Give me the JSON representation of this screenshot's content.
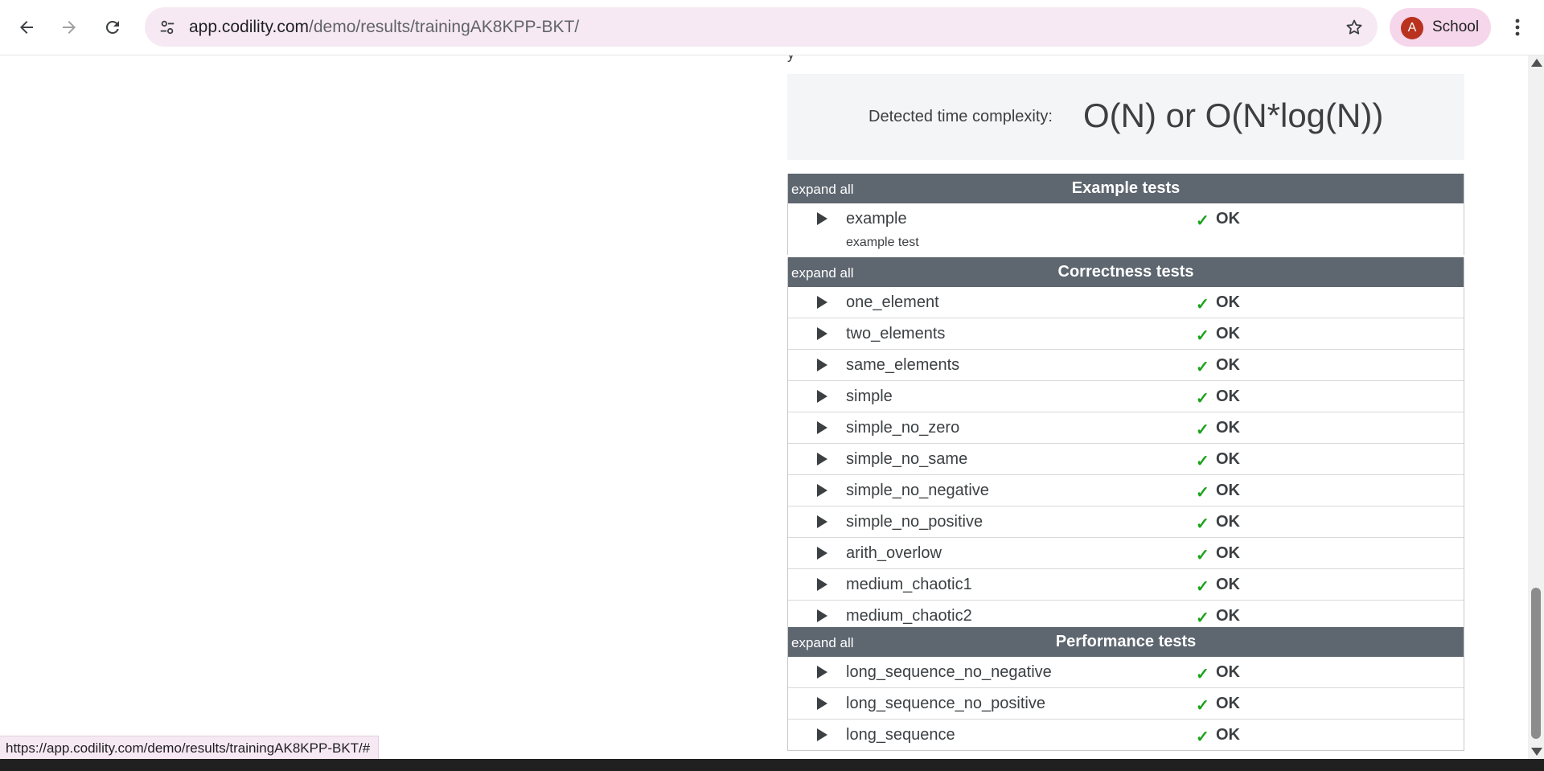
{
  "browser": {
    "url_host": "app.codility.com",
    "url_path": "/demo/results/trainingAK8KPP-BKT/",
    "profile_initial": "A",
    "profile_label": "School"
  },
  "complexity": {
    "partial_text": "y",
    "label": "Detected time complexity:",
    "value": "O(N) or O(N*log(N))"
  },
  "groups": [
    {
      "expand_label": "expand all",
      "title": "Example tests",
      "tests": [
        {
          "name": "example",
          "subtitle": "example test",
          "status": "OK"
        }
      ]
    },
    {
      "expand_label": "expand all",
      "title": "Correctness tests",
      "tests": [
        {
          "name": "one_element",
          "status": "OK"
        },
        {
          "name": "two_elements",
          "status": "OK"
        },
        {
          "name": "same_elements",
          "status": "OK"
        },
        {
          "name": "simple",
          "status": "OK"
        },
        {
          "name": "simple_no_zero",
          "status": "OK"
        },
        {
          "name": "simple_no_same",
          "status": "OK"
        },
        {
          "name": "simple_no_negative",
          "status": "OK"
        },
        {
          "name": "simple_no_positive",
          "status": "OK"
        },
        {
          "name": "arith_overlow",
          "status": "OK"
        },
        {
          "name": "medium_chaotic1",
          "status": "OK"
        },
        {
          "name": "medium_chaotic2",
          "status": "OK"
        }
      ]
    },
    {
      "expand_label": "expand all",
      "title": "Performance tests",
      "tests": [
        {
          "name": "long_sequence_no_negative",
          "status": "OK"
        },
        {
          "name": "long_sequence_no_positive",
          "status": "OK"
        },
        {
          "name": "long_sequence",
          "status": "OK"
        }
      ]
    }
  ],
  "status_check_glyph": "✓",
  "status_bar": {
    "text": "https://app.codility.com/demo/results/trainingAK8KPP-BKT/#"
  },
  "colors": {
    "header_bg": "#5e6670",
    "ok_check": "#1aa31a",
    "omnibox_bg": "#f7e9f3",
    "avatar_bg": "#b8321f"
  },
  "icons": {
    "back": "back-arrow-icon",
    "forward": "forward-arrow-icon",
    "reload": "reload-icon",
    "site_info": "tune-icon",
    "bookmark": "star-icon",
    "menu": "kebab-menu-icon",
    "expand_row": "triangle-right-icon",
    "status_ok": "checkmark-icon"
  }
}
